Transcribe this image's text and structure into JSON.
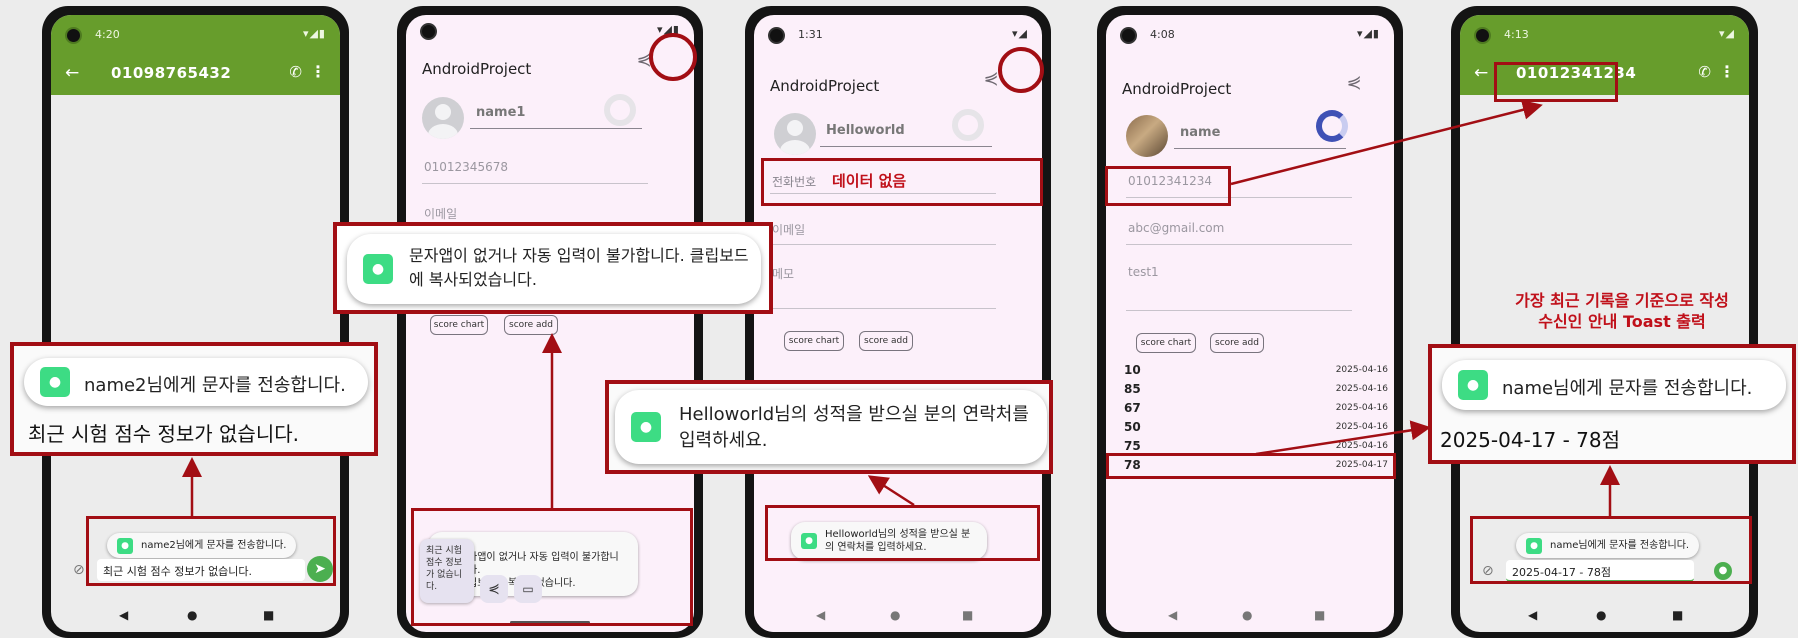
{
  "colors": {
    "sms_green": "#679d2c",
    "annotation_red": "#a20e14",
    "note_red": "#c0101a",
    "app_bg": "#fcf0fa"
  },
  "phone1": {
    "time": "4:20",
    "phone_number": "01098765432",
    "toast": "name2님에게 문자를 전송합니다.",
    "message": "최근 시험 점수 정보가 없습니다.",
    "callout": {
      "toast": "name2님에게 문자를 전송합니다.",
      "message": "최근 시험 점수 정보가 없습니다."
    }
  },
  "phone2": {
    "app_title": "AndroidProject",
    "name": "name1",
    "phone": "01012345678",
    "email_label": "이메일",
    "btn_chart": "score chart",
    "btn_add": "score add",
    "clip_toast": "자앱이 없거나 자동 입력이 불가합니다.\n립보드에 복사되었습니다.",
    "clip_preview": "최근 시험 점수 정보가 없습니다.",
    "callout": "문자앱이 없거나 자동 입력이 불가합니다. 클립보드에 복사되었습니다."
  },
  "phone3": {
    "time": "1:31",
    "app_title": "AndroidProject",
    "name": "Helloworld",
    "phone_label": "전화번호",
    "no_data": "데이터 없음",
    "email_label": "이메일",
    "memo_label": "메모",
    "btn_chart": "score chart",
    "btn_add": "score add",
    "toast": "Helloworld님의 성적을 받으실 분의 연락처를 입력하세요.",
    "callout": "Helloworld님의 성적을 받으실 분의 연락처를 입력하세요."
  },
  "phone4": {
    "time": "4:08",
    "app_title": "AndroidProject",
    "name": "name",
    "phone": "01012341234",
    "email": "abc@gmail.com",
    "memo": "test1",
    "btn_chart": "score chart",
    "btn_add": "score add",
    "scores": [
      {
        "score": "10",
        "date": "2025-04-16"
      },
      {
        "score": "85",
        "date": "2025-04-16"
      },
      {
        "score": "67",
        "date": "2025-04-16"
      },
      {
        "score": "50",
        "date": "2025-04-16"
      },
      {
        "score": "75",
        "date": "2025-04-16"
      },
      {
        "score": "78",
        "date": "2025-04-17"
      }
    ]
  },
  "phone5": {
    "time": "4:13",
    "phone_number": "01012341234",
    "toast": "name님에게 문자를 전송합니다.",
    "message": "2025-04-17 - 78점",
    "note": "가장 최근 기록을 기준으로 작성\n수신인 안내 Toast 출력",
    "callout": {
      "toast": "name님에게 문자를 전송합니다.",
      "message": "2025-04-17 - 78점"
    }
  },
  "nav": {
    "back": "◀",
    "home": "●",
    "recents": "■"
  }
}
